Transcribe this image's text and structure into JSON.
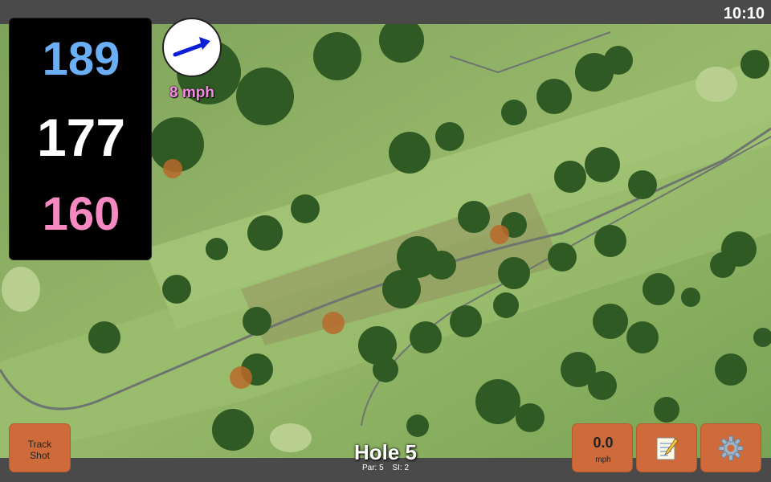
{
  "status": {
    "time": "10:10"
  },
  "distances": {
    "back": "189",
    "middle": "177",
    "front": "160"
  },
  "wind": {
    "speed": "8 mph",
    "arrow_icon": "arrow-right-icon"
  },
  "hole": {
    "title": "Hole 5",
    "par": "Par: 5",
    "si": "SI: 2"
  },
  "buttons": {
    "track_shot": [
      "Track",
      "Shot"
    ],
    "speed_value": "0.0",
    "speed_unit": "mph",
    "notes_icon": "notepad-icon",
    "settings_icon": "gear-icon"
  },
  "colors": {
    "back": "#6aaef5",
    "middle": "#ffffff",
    "front": "#f589c2",
    "wind_text": "#f589e4",
    "button": "#cf6b3a",
    "arrow": "#0a1fd6"
  }
}
